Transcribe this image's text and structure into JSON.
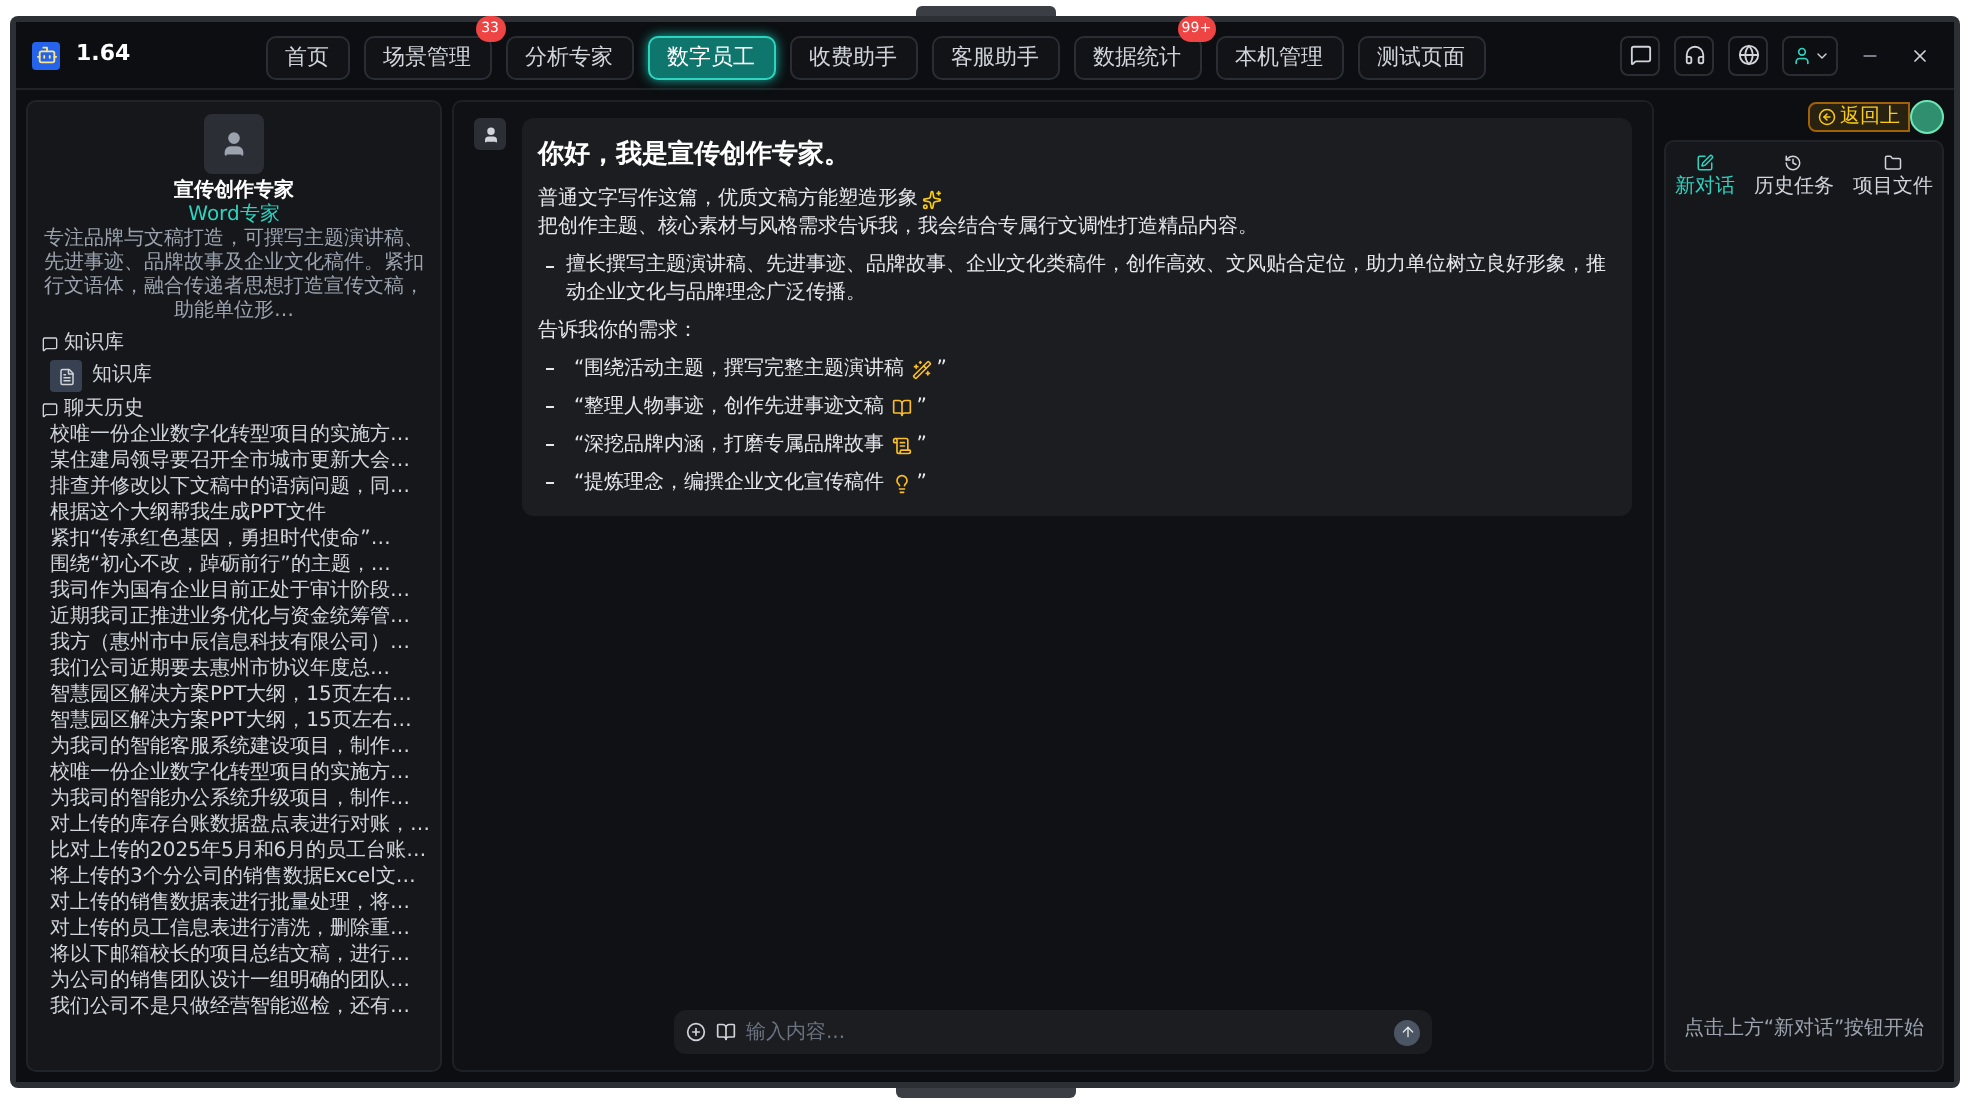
{
  "app": {
    "version": "1.64"
  },
  "nav_tabs": [
    {
      "label": "首页",
      "selected": false
    },
    {
      "label": "场景管理",
      "selected": false,
      "badge": "33"
    },
    {
      "label": "分析专家",
      "selected": false
    },
    {
      "label": "数字员工",
      "selected": true
    },
    {
      "label": "收费助手",
      "selected": false
    },
    {
      "label": "客服助手",
      "selected": false
    },
    {
      "label": "数据统计",
      "selected": false,
      "badge": "99+"
    },
    {
      "label": "本机管理",
      "selected": false
    },
    {
      "label": "测试页面",
      "selected": false
    }
  ],
  "sidebar": {
    "expert": {
      "name": "宣传创作专家",
      "type": "Word专家",
      "description": "专注品牌与文稿打造，可撰写主题演讲稿、先进事迹、品牌故事及企业文化稿件。紧扣行文语体，融合传递者思想打造宣传文稿，助能单位形…"
    },
    "knowledge_base": {
      "title": "知识库",
      "items": [
        "知识库"
      ]
    },
    "chat_history": {
      "title": "聊天历史",
      "items": [
        "校唯一份企业数字化转型项目的实施方…",
        "某住建局领导要召开全市城市更新大会…",
        "排查并修改以下文稿中的语病问题，同…",
        "根据这个大纲帮我生成PPT文件",
        "紧扣“传承红色基因，勇担时代使命”…",
        "围绕“初心不改，踔砺前行”的主题，…",
        "我司作为国有企业目前正处于审计阶段…",
        "近期我司正推进业务优化与资金统筹管…",
        "我方（惠州市中辰信息科技有限公司）…",
        "我们公司近期要去惠州市协议年度总…",
        "智慧园区解决方案PPT大纲，15页左右…",
        "智慧园区解决方案PPT大纲，15页左右…",
        "为我司的智能客服系统建设项目，制作…",
        "校唯一份企业数字化转型项目的实施方…",
        "为我司的智能办公系统升级项目，制作…",
        "对上传的库存台账数据盘点表进行对账，…",
        "比对上传的2025年5月和6月的员工台账…",
        "将上传的3个分公司的销售数据Excel文…",
        "对上传的销售数据表进行批量处理，将…",
        "对上传的员工信息表进行清洗，删除重…",
        "将以下邮箱校长的项目总结文稿，进行…",
        "为公司的销售团队设计一组明确的团队…",
        "我们公司不是只做经营智能巡检，还有…"
      ]
    }
  },
  "chat": {
    "message": {
      "title": "你好，我是宣传创作专家。",
      "intro": [
        "普通文字写作这篇，优质文稿方能塑造形象",
        "把创作主题、核心素材与风格需求告诉我，我会结合专属行文调性打造精品内容。"
      ],
      "bullet": "擅长撰写主题演讲稿、先进事迹、品牌故事、企业文化类稿件，创作高效、文风贴合定位，助力单位树立良好形象，推动企业文化与品牌理念广泛传播。",
      "prompt_label": "告诉我你的需求：",
      "suggestions": [
        "“围绕活动主题，撰写完整主题演讲稿",
        "“整理人物事迹，创作先进事迹文稿",
        "“深挖品牌内涵，打磨专属品牌故事",
        "“提炼理念，编撰企业文化宣传稿件"
      ],
      "quote_close": "”"
    },
    "input": {
      "placeholder": "输入内容..."
    }
  },
  "right_panel": {
    "back_button": "返回上",
    "tabs": [
      {
        "label": "新对话",
        "selected": true
      },
      {
        "label": "历史任务",
        "selected": false
      },
      {
        "label": "项目文件",
        "selected": false
      }
    ],
    "empty_hint": "点击上方“新对话”按钮开始"
  }
}
